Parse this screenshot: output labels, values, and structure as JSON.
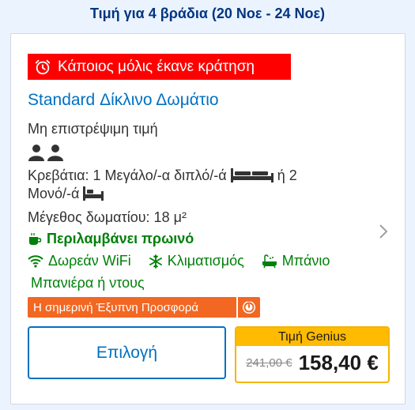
{
  "header": {
    "price_for_nights": "Τιμή για 4 βράδια (20 Νοε - 24 Νοε)"
  },
  "room": {
    "booking_alert": "Κάποιος μόλις έκανε κράτηση",
    "name": "Standard Δίκλινο Δωμάτιο",
    "policy": "Μη επιστρέψιμη τιμή",
    "beds_part1": "Κρεβάτια: 1 Μεγάλο/-α διπλό/-ά",
    "beds_part2": "ή 2",
    "beds_part3": "Μονό/-ά",
    "size": "Μέγεθος δωματίου: 18 μ²",
    "breakfast": "Περιλαμβάνει πρωινό",
    "amenities": {
      "wifi": "Δωρεάν WiFi",
      "ac": "Κλιματισμός",
      "bath": "Μπάνιο",
      "bath_type": "Μπανιέρα ή ντους"
    },
    "smart_deal": "Η σημερινή Έξυπνη Προσφορά"
  },
  "actions": {
    "select_label": "Επιλογή"
  },
  "pricing": {
    "genius_label": "Τιμή Genius",
    "old_price": "241,00 €",
    "new_price": "158,40 €"
  },
  "colors": {
    "brand_blue": "#0071c2",
    "header_blue": "#003580",
    "alert_red": "#ff0000",
    "green": "#008009",
    "deal_orange": "#f26722",
    "genius_yellow": "#febb02"
  }
}
